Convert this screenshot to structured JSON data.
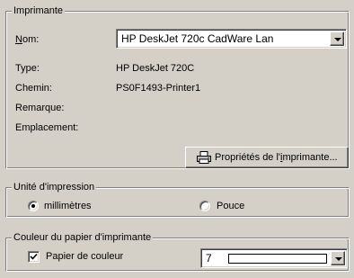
{
  "printer_group": {
    "legend": "Imprimante",
    "name_label_u": "N",
    "name_label_rest": "om:",
    "name_value": "HP DeskJet 720c CadWare Lan",
    "type_label": "Type:",
    "type_value": "HP DeskJet 720C",
    "path_label": "Chemin:",
    "path_value": "PS0F1493-Printer1",
    "remark_label": "Remarque:",
    "location_label": "Emplacement:",
    "properties_button_pre": "Propriétés de l'",
    "properties_button_u": "i",
    "properties_button_post": "mprimante..."
  },
  "unit_group": {
    "legend": "Unité d'impression",
    "option_mm": "millimètres",
    "option_inch": "Pouce",
    "selected": "millimètres"
  },
  "paper_color_group": {
    "legend": "Couleur du papier d'imprimante",
    "checkbox_label": "Papier de couleur",
    "checked": true,
    "color_value": "7",
    "swatch_color": "#ffffff"
  },
  "icons": {
    "printer": "printer-icon",
    "dropdown": "chevron-down-icon",
    "check": "checkmark-icon"
  }
}
